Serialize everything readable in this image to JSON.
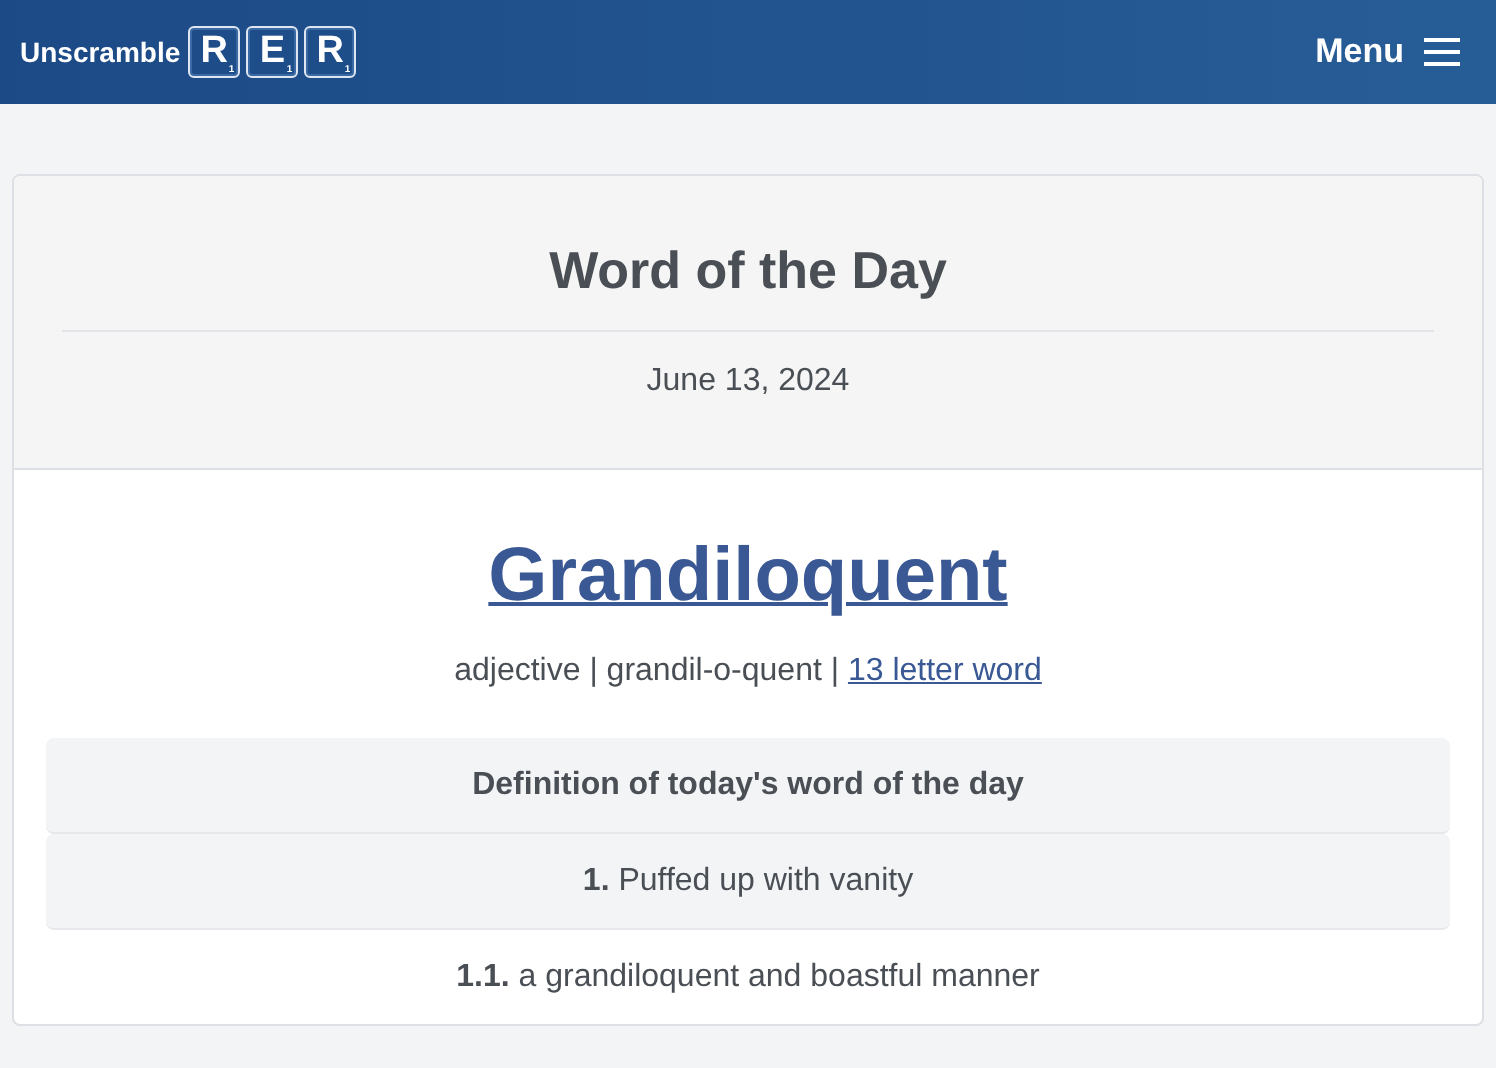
{
  "header": {
    "brand": "Unscramble",
    "tiles": [
      {
        "letter": "R",
        "points": "1"
      },
      {
        "letter": "E",
        "points": "1"
      },
      {
        "letter": "R",
        "points": "1"
      }
    ],
    "menu": "Menu"
  },
  "card": {
    "title": "Word of the Day",
    "date": "June 13, 2024",
    "word": "Grandiloquent",
    "meta": "adjective | grandil-o-quent | ",
    "length_link": "13 letter word",
    "definitions": {
      "heading": "Definition of today's word of the day",
      "rows": [
        {
          "kind": "shaded",
          "text": "**1.** Puffed up with vanity"
        },
        {
          "kind": "plain",
          "text": "**1.1.** a grandiloquent and boastful manner"
        }
      ]
    }
  }
}
